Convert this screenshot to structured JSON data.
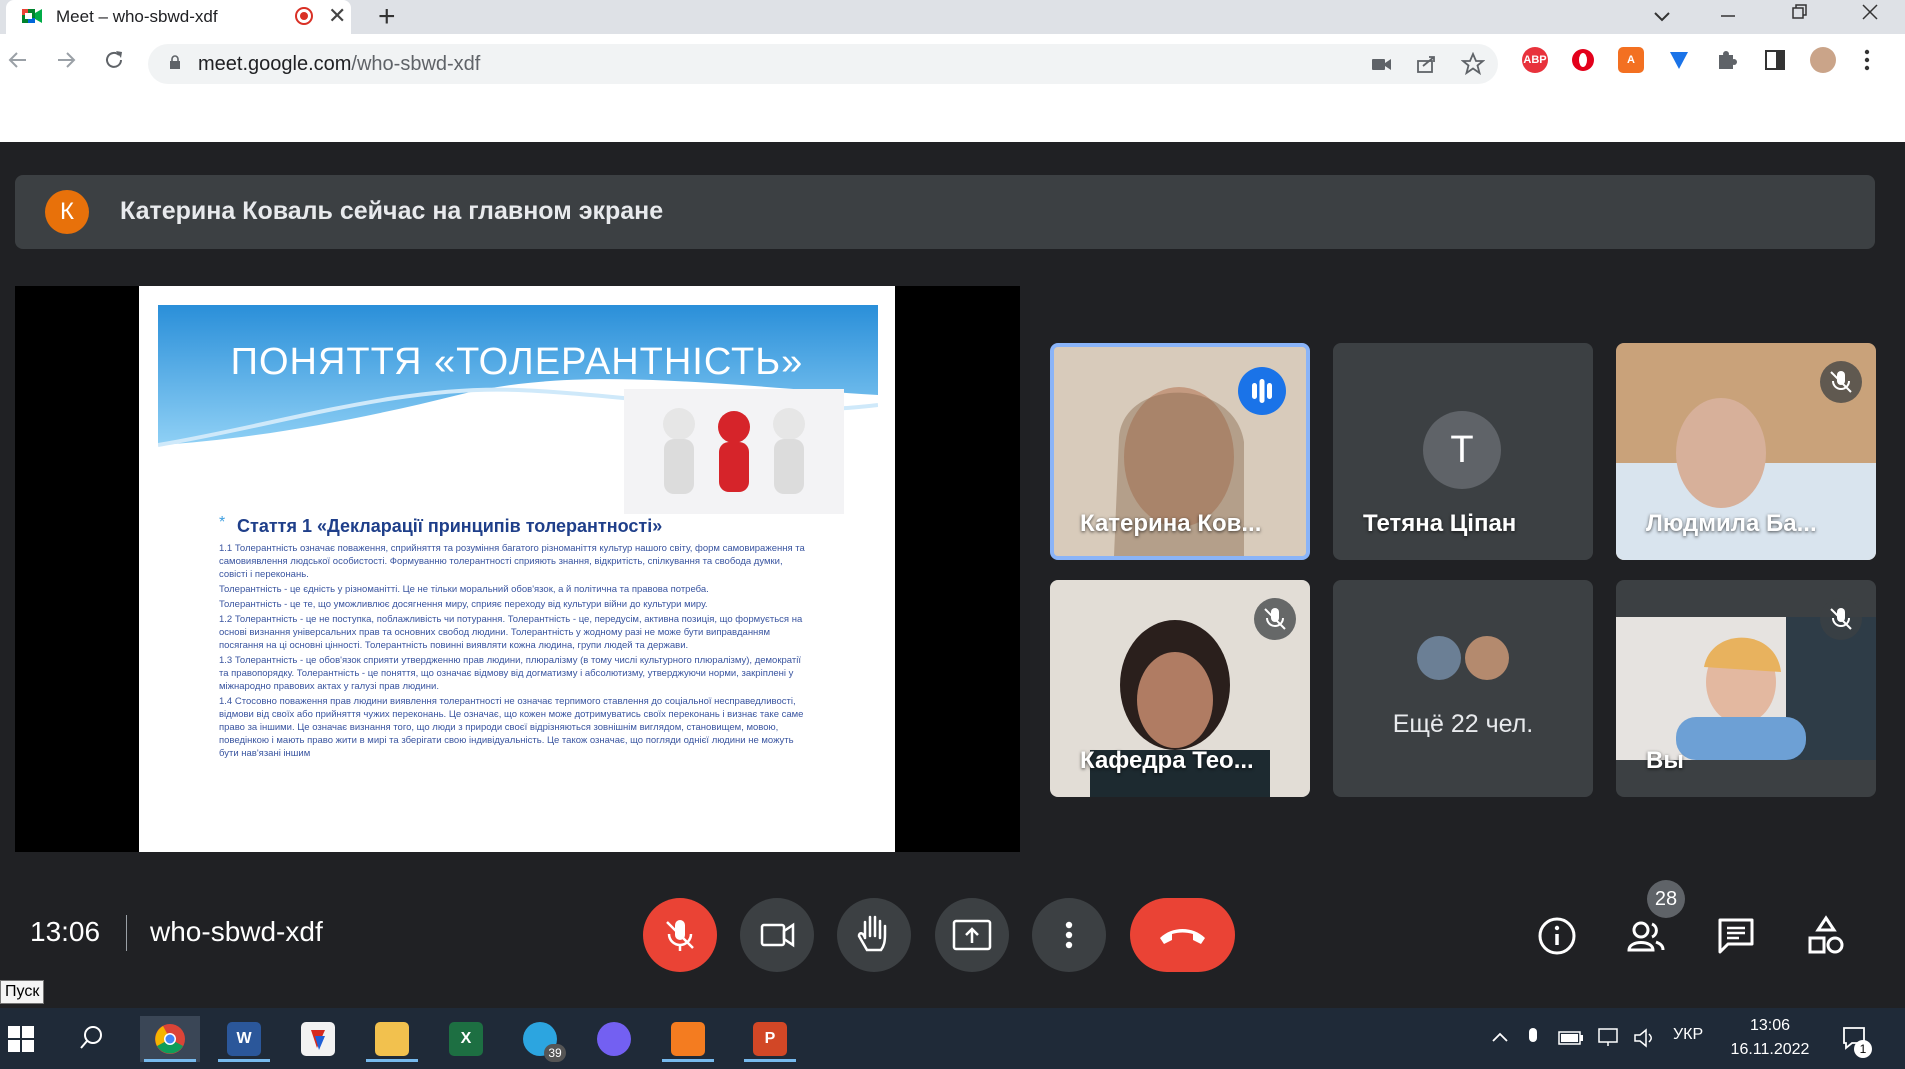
{
  "browser": {
    "tab_title": "Meet – who-sbwd-xdf",
    "url_host": "meet.google.com",
    "url_path": "/who-sbwd-xdf",
    "new_tab": "+",
    "close_tab": "✕",
    "extensions": [
      "ABP",
      "opera-icon",
      "A",
      "wallet-icon",
      "puzzle-icon",
      "sidepanel-icon",
      "profile-avatar",
      "more-icon"
    ]
  },
  "meet": {
    "banner": {
      "avatar_letter": "К",
      "text": "Катерина Коваль сейчас на главном экране"
    },
    "slide": {
      "title": "ПОНЯТТЯ «ТОЛЕРАНТНІСТЬ»",
      "subtitle": "Стаття 1  «Декларації принципів толерантності»",
      "paragraphs": [
        "1.1 Толерантність означає поваження, сприйняття та розуміння багатого різноманіття культур нашого світу, форм самовираження та самовиявлення людської особистості. Формуванню толерантності сприяють знання, відкритість, спілкування та свобода думки, совісті і переконань.",
        "Толерантність - це єдність у різноманітті. Це не тільки моральний обов'язок, а й політична та правова потреба.",
        "Толерантність - це те, що уможливлює досягнення миру, сприяє переходу від культури війни до культури миру.",
        "1.2 Толерантність - це не поступка, поблажливість чи потурання. Толерантність - це, передусім, активна позиція, що формується на основі визнання універсальних прав та основних свобод людини. Толерантність у жодному разі не може бути виправданням посягання на ці основні цінності. Толерантність повинні виявляти кожна людина, групи людей та держави.",
        "1.3 Толерантність - це обов'язок сприяти утвердженню прав людини, плюралізму (в тому числі культурного плюралізму), демократії та правопорядку. Толерантність - це поняття, що означає відмову від догматизму і абсолютизму, утверджуючи норми, закріплені у міжнародно правових актах у галузі прав людини.",
        "1.4 Стосовно поваження прав людини виявлення толерантності не означає терпимого ставлення до соціальної несправедливості, відмови від своїх або прийняття чужих переконань. Це означає, що кожен може дотримуватись своїх переконань і визнає таке саме право за іншими. Це означає визнання того, що люди з природи своєї відрізняються зовнішнім виглядом, становищем, мовою, поведінкою і мають право жити в мирі та зберігати свою індивідуальність. Це також означає, що погляди однієї людини не можуть бути нав'язані іншим"
      ]
    },
    "participants": [
      {
        "name": "Катерина Ков...",
        "state": "speaking"
      },
      {
        "name": "Тетяна Ціпан",
        "avatar_letter": "Т"
      },
      {
        "name": "Людмила Ба...",
        "state": "muted"
      },
      {
        "name": "Кафедра Тео...",
        "state": "muted"
      },
      {
        "name": "Ещё 22 чел."
      },
      {
        "name": "Вы",
        "state": "muted"
      }
    ],
    "time": "13:06",
    "meeting_code": "who-sbwd-xdf",
    "participant_count": "28"
  },
  "taskbar": {
    "tooltip": "Пуск",
    "telegram_badge": "39",
    "lang": "УКР",
    "time": "13:06",
    "date": "16.11.2022",
    "notif_count": "1"
  },
  "colors": {
    "meet_bg": "#202124",
    "tile": "#3c4043",
    "red": "#ea4335",
    "blue": "#1a73e8"
  }
}
